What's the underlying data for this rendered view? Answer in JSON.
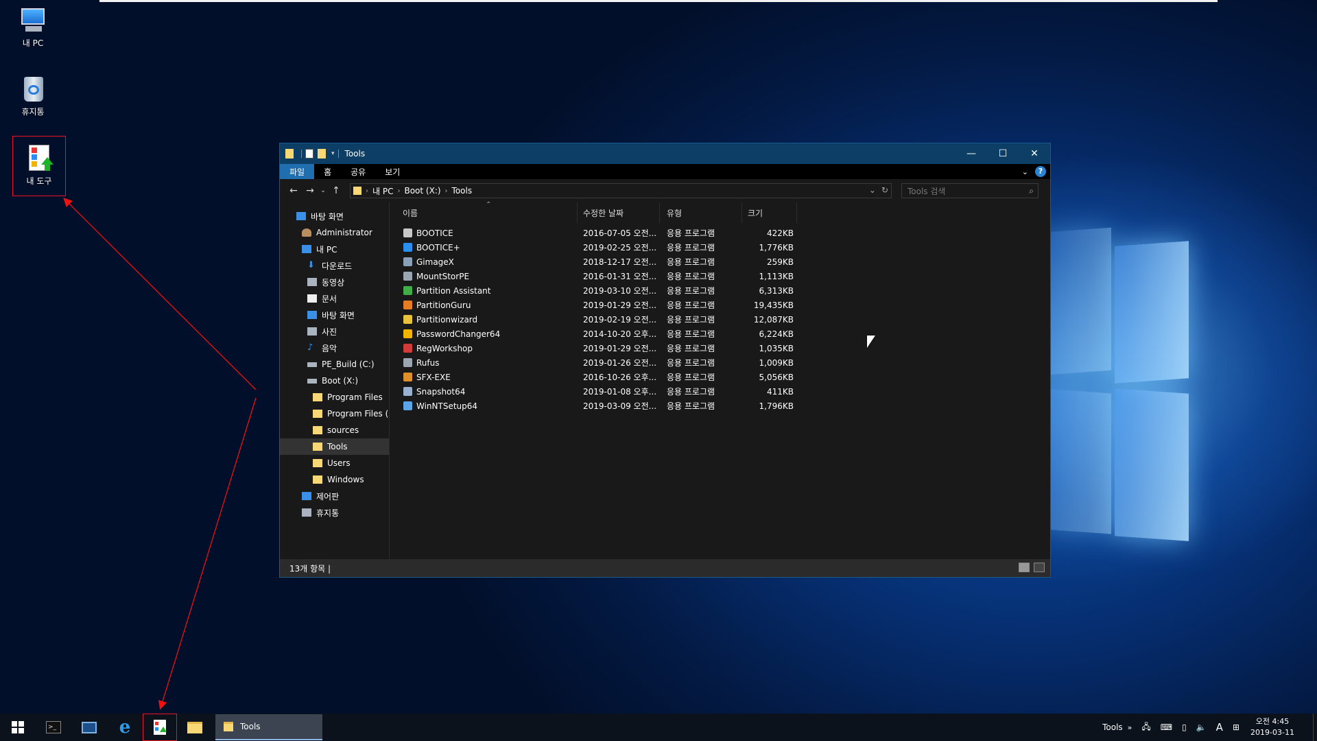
{
  "desktop": {
    "icons": [
      {
        "label": "내 PC"
      },
      {
        "label": "휴지통"
      },
      {
        "label": "내 도구"
      }
    ]
  },
  "window": {
    "title": "Tools",
    "ribbon_tabs": [
      "파일",
      "홈",
      "공유",
      "보기"
    ],
    "help_glyph": "?",
    "address": {
      "crumbs": [
        "내 PC",
        "Boot (X:)",
        "Tools"
      ]
    },
    "search_placeholder": "Tools 검색",
    "nav_tree": [
      {
        "label": "바탕 화면",
        "icon": "desktop-icon"
      },
      {
        "label": "Administrator",
        "icon": "user-icon"
      },
      {
        "label": "내 PC",
        "icon": "pc-icon"
      },
      {
        "label": "다운로드",
        "icon": "download-icon"
      },
      {
        "label": "동영상",
        "icon": "video-icon"
      },
      {
        "label": "문서",
        "icon": "document-icon"
      },
      {
        "label": "바탕 화면",
        "icon": "desktop-icon"
      },
      {
        "label": "사진",
        "icon": "picture-icon"
      },
      {
        "label": "음악",
        "icon": "music-icon"
      },
      {
        "label": "PE_Build (C:)",
        "icon": "drive-icon"
      },
      {
        "label": "Boot (X:)",
        "icon": "drive-icon"
      },
      {
        "label": "Program Files",
        "icon": "folder-icon"
      },
      {
        "label": "Program Files (x",
        "icon": "folder-icon"
      },
      {
        "label": "sources",
        "icon": "folder-icon"
      },
      {
        "label": "Tools",
        "icon": "folder-icon",
        "selected": true
      },
      {
        "label": "Users",
        "icon": "folder-icon"
      },
      {
        "label": "Windows",
        "icon": "folder-icon"
      },
      {
        "label": "제어판",
        "icon": "control-panel-icon"
      },
      {
        "label": "휴지통",
        "icon": "recycle-bin-icon"
      }
    ],
    "columns": [
      "이름",
      "수정한 날짜",
      "유형",
      "크기"
    ],
    "files": [
      {
        "name": "BOOTICE",
        "date": "2016-07-05 오전...",
        "type": "응용 프로그램",
        "size": "422KB",
        "color": "#c8c8c8"
      },
      {
        "name": "BOOTICE+",
        "date": "2019-02-25 오전...",
        "type": "응용 프로그램",
        "size": "1,776KB",
        "color": "#2a8ff0"
      },
      {
        "name": "GimageX",
        "date": "2018-12-17 오전...",
        "type": "응용 프로그램",
        "size": "259KB",
        "color": "#8aa0b8"
      },
      {
        "name": "MountStorPE",
        "date": "2016-01-31 오전...",
        "type": "응용 프로그램",
        "size": "1,113KB",
        "color": "#9aa6b2"
      },
      {
        "name": "Partition Assistant",
        "date": "2019-03-10 오전...",
        "type": "응용 프로그램",
        "size": "6,313KB",
        "color": "#3fae49"
      },
      {
        "name": "PartitionGuru",
        "date": "2019-01-29 오전...",
        "type": "응용 프로그램",
        "size": "19,435KB",
        "color": "#e77d22"
      },
      {
        "name": "Partitionwizard",
        "date": "2019-02-19 오전...",
        "type": "응용 프로그램",
        "size": "12,087KB",
        "color": "#e8c23a"
      },
      {
        "name": "PasswordChanger64",
        "date": "2014-10-20 오후...",
        "type": "응용 프로그램",
        "size": "6,224KB",
        "color": "#f0b400"
      },
      {
        "name": "RegWorkshop",
        "date": "2019-01-29 오전...",
        "type": "응용 프로그램",
        "size": "1,035KB",
        "color": "#d33b3b"
      },
      {
        "name": "Rufus",
        "date": "2019-01-26 오전...",
        "type": "응용 프로그램",
        "size": "1,009KB",
        "color": "#9aa6b2"
      },
      {
        "name": "SFX-EXE",
        "date": "2016-10-26 오후...",
        "type": "응용 프로그램",
        "size": "5,056KB",
        "color": "#e0902a"
      },
      {
        "name": "Snapshot64",
        "date": "2019-01-08 오후...",
        "type": "응용 프로그램",
        "size": "411KB",
        "color": "#9ab2d0"
      },
      {
        "name": "WinNTSetup64",
        "date": "2019-03-09 오전...",
        "type": "응용 프로그램",
        "size": "1,796KB",
        "color": "#5aa6e8"
      }
    ],
    "status": "13개 항목  |"
  },
  "taskbar": {
    "active_app": "Tools",
    "tray_toolbar": "Tools",
    "tray_chevron": "»",
    "ime": "A",
    "clock_time": "오전 4:45",
    "clock_date": "2019-03-11"
  },
  "colors": {
    "window_titlebar": "#0d3f66",
    "ribbon_active_tab": "#1f6fb0",
    "annotation": "#e11"
  }
}
